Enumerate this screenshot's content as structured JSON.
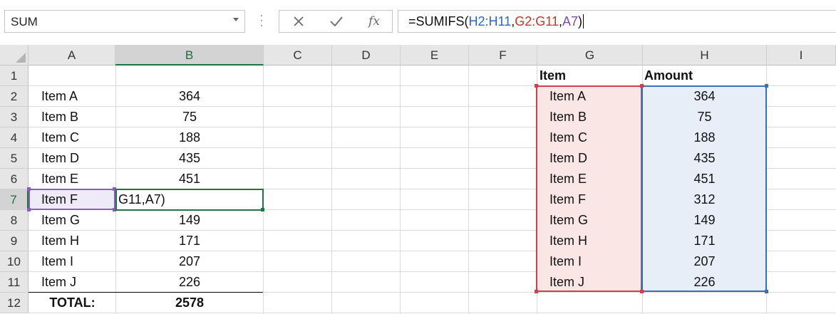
{
  "name_box": {
    "value": "SUM"
  },
  "formula_bar": {
    "cancel_icon": "x-icon",
    "enter_icon": "check-icon",
    "fx_label": "fx",
    "formula": {
      "prefix": "=SUMIFS(",
      "arg1": "H2:H11",
      "sep1": ",",
      "arg2": "G2:G11",
      "sep2": ",",
      "arg3": "A7",
      "suffix": ")"
    }
  },
  "columns": [
    "A",
    "B",
    "C",
    "D",
    "E",
    "F",
    "G",
    "H",
    "I"
  ],
  "rows": [
    "1",
    "2",
    "3",
    "4",
    "5",
    "6",
    "7",
    "8",
    "9",
    "10",
    "11",
    "12"
  ],
  "column_a": [
    "",
    "Item A",
    "Item B",
    "Item C",
    "Item D",
    "Item E",
    "Item F",
    "Item G",
    "Item H",
    "Item I",
    "Item J",
    "TOTAL:"
  ],
  "column_b": [
    "",
    "364",
    "75",
    "188",
    "435",
    "451",
    "G11,A7)",
    "149",
    "171",
    "207",
    "226",
    "2578"
  ],
  "column_g": [
    "Item",
    "Item A",
    "Item B",
    "Item C",
    "Item D",
    "Item E",
    "Item F",
    "Item G",
    "Item H",
    "Item I",
    "Item J"
  ],
  "column_h": [
    "Amount",
    "364",
    "75",
    "188",
    "435",
    "451",
    "312",
    "149",
    "171",
    "207",
    "226"
  ],
  "colors": {
    "range_h": "#3b6fb8",
    "range_g": "#c8434a",
    "ref_a7": "#8560b8",
    "active_cell": "#217346"
  }
}
